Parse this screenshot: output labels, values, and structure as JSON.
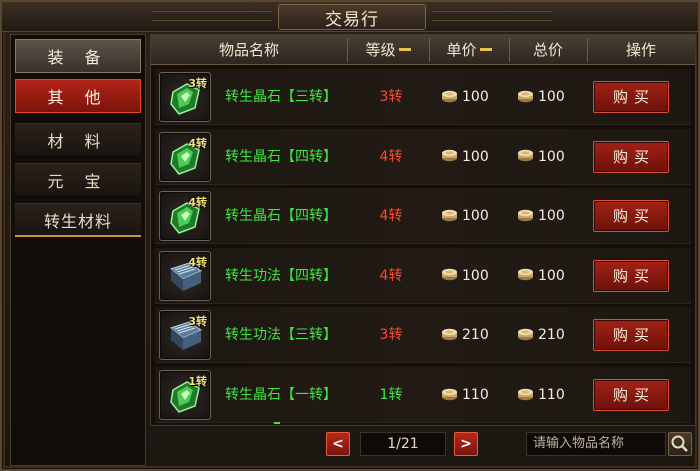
{
  "window": {
    "title": "交易行"
  },
  "sidebar": {
    "items": [
      {
        "label": "装 备"
      },
      {
        "label": "其 他"
      },
      {
        "label": "材 料"
      },
      {
        "label": "元 宝"
      },
      {
        "label": "转生材料"
      }
    ],
    "active_index": 1
  },
  "table": {
    "headers": {
      "name": "物品名称",
      "level": "等级",
      "unit_price": "单价",
      "total_price": "总价",
      "action": "操作"
    },
    "rows": [
      {
        "icon": "green-crystal-icon",
        "tier_badge": "3转",
        "name": "转生晶石【三转】",
        "level": "3转",
        "level_color": "#ff4a2a",
        "unit_price": "100",
        "total_price": "100",
        "buy_label": "购买"
      },
      {
        "icon": "green-crystal-icon",
        "tier_badge": "4转",
        "name": "转生晶石【四转】",
        "level": "4转",
        "level_color": "#ff4a2a",
        "unit_price": "100",
        "total_price": "100",
        "buy_label": "购买"
      },
      {
        "icon": "green-crystal-icon",
        "tier_badge": "4转",
        "name": "转生晶石【四转】",
        "level": "4转",
        "level_color": "#ff4a2a",
        "unit_price": "100",
        "total_price": "100",
        "buy_label": "购买"
      },
      {
        "icon": "skill-book-icon",
        "tier_badge": "4转",
        "name": "转生功法【四转】",
        "level": "4转",
        "level_color": "#ff4a2a",
        "unit_price": "100",
        "total_price": "100",
        "buy_label": "购买"
      },
      {
        "icon": "skill-book-icon",
        "tier_badge": "3转",
        "name": "转生功法【三转】",
        "level": "3转",
        "level_color": "#ff4a2a",
        "unit_price": "210",
        "total_price": "210",
        "buy_label": "购买"
      },
      {
        "icon": "green-crystal-icon",
        "tier_badge": "1转",
        "name": "转生晶石【一转】",
        "level": "1转",
        "level_color": "#3ee63e",
        "unit_price": "110",
        "total_price": "110",
        "buy_label": "购买"
      }
    ]
  },
  "pager": {
    "prev": "<",
    "next": ">",
    "page_text": "1/21"
  },
  "search": {
    "placeholder": "请输入物品名称"
  },
  "colors": {
    "accent_red": "#b32418",
    "item_green": "#3ee63e",
    "level_red": "#ff4a2a"
  }
}
